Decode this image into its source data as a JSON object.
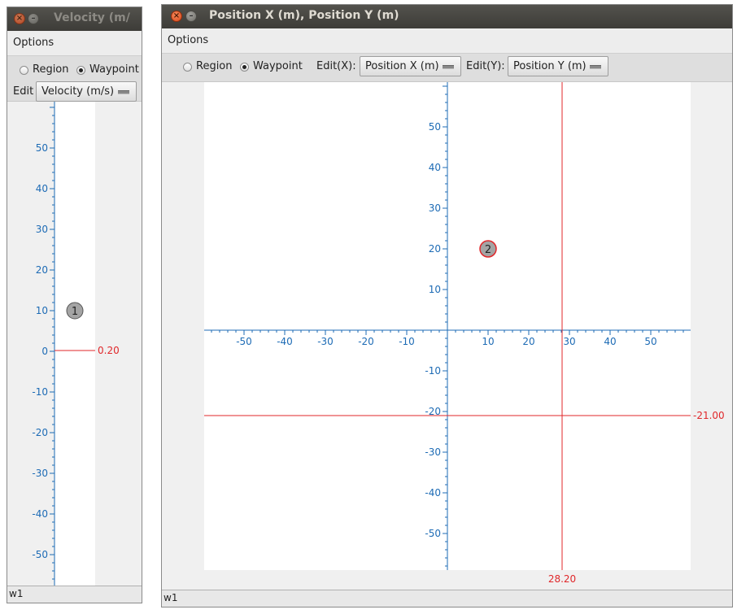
{
  "velocity_window": {
    "title": "Velocity (m/",
    "menu": {
      "options": "Options"
    },
    "mode": {
      "region": "Region",
      "waypoint": "Waypoint",
      "selected": "Waypoint"
    },
    "edit_label": "Edit",
    "edit_value": "Velocity (m/s)",
    "axis": {
      "ticks": [
        50,
        40,
        30,
        20,
        10,
        0,
        -10,
        -20,
        -30,
        -40,
        -50
      ]
    },
    "cursor_value": "0.20",
    "waypoint": {
      "label": "1",
      "y": 10
    },
    "status": "w1"
  },
  "position_window": {
    "title": "Position X (m), Position Y (m)",
    "menu": {
      "options": "Options"
    },
    "mode": {
      "region": "Region",
      "waypoint": "Waypoint",
      "selected": "Waypoint"
    },
    "edit_x_label": "Edit(X):",
    "edit_x_value": "Position X (m)",
    "edit_y_label": "Edit(Y):",
    "edit_y_value": "Position Y (m)",
    "axis": {
      "x_ticks": [
        -50,
        -40,
        -30,
        -20,
        -10,
        10,
        20,
        30,
        40,
        50
      ],
      "y_ticks": [
        50,
        40,
        30,
        20,
        10,
        -10,
        -20,
        -30,
        -40,
        -50
      ]
    },
    "cursor": {
      "x": 28.2,
      "y": -21.0,
      "x_label": "28.20",
      "y_label": "-21.00"
    },
    "waypoint": {
      "label": "2",
      "x": 10,
      "y": 20
    },
    "status": "w1"
  },
  "colors": {
    "axis": "#1d6bb5",
    "cursor": "#e0272a",
    "titlebar": "#3c3b37"
  },
  "icons": [
    "close-icon",
    "minimize-icon",
    "dropdown-arrow-icon"
  ]
}
